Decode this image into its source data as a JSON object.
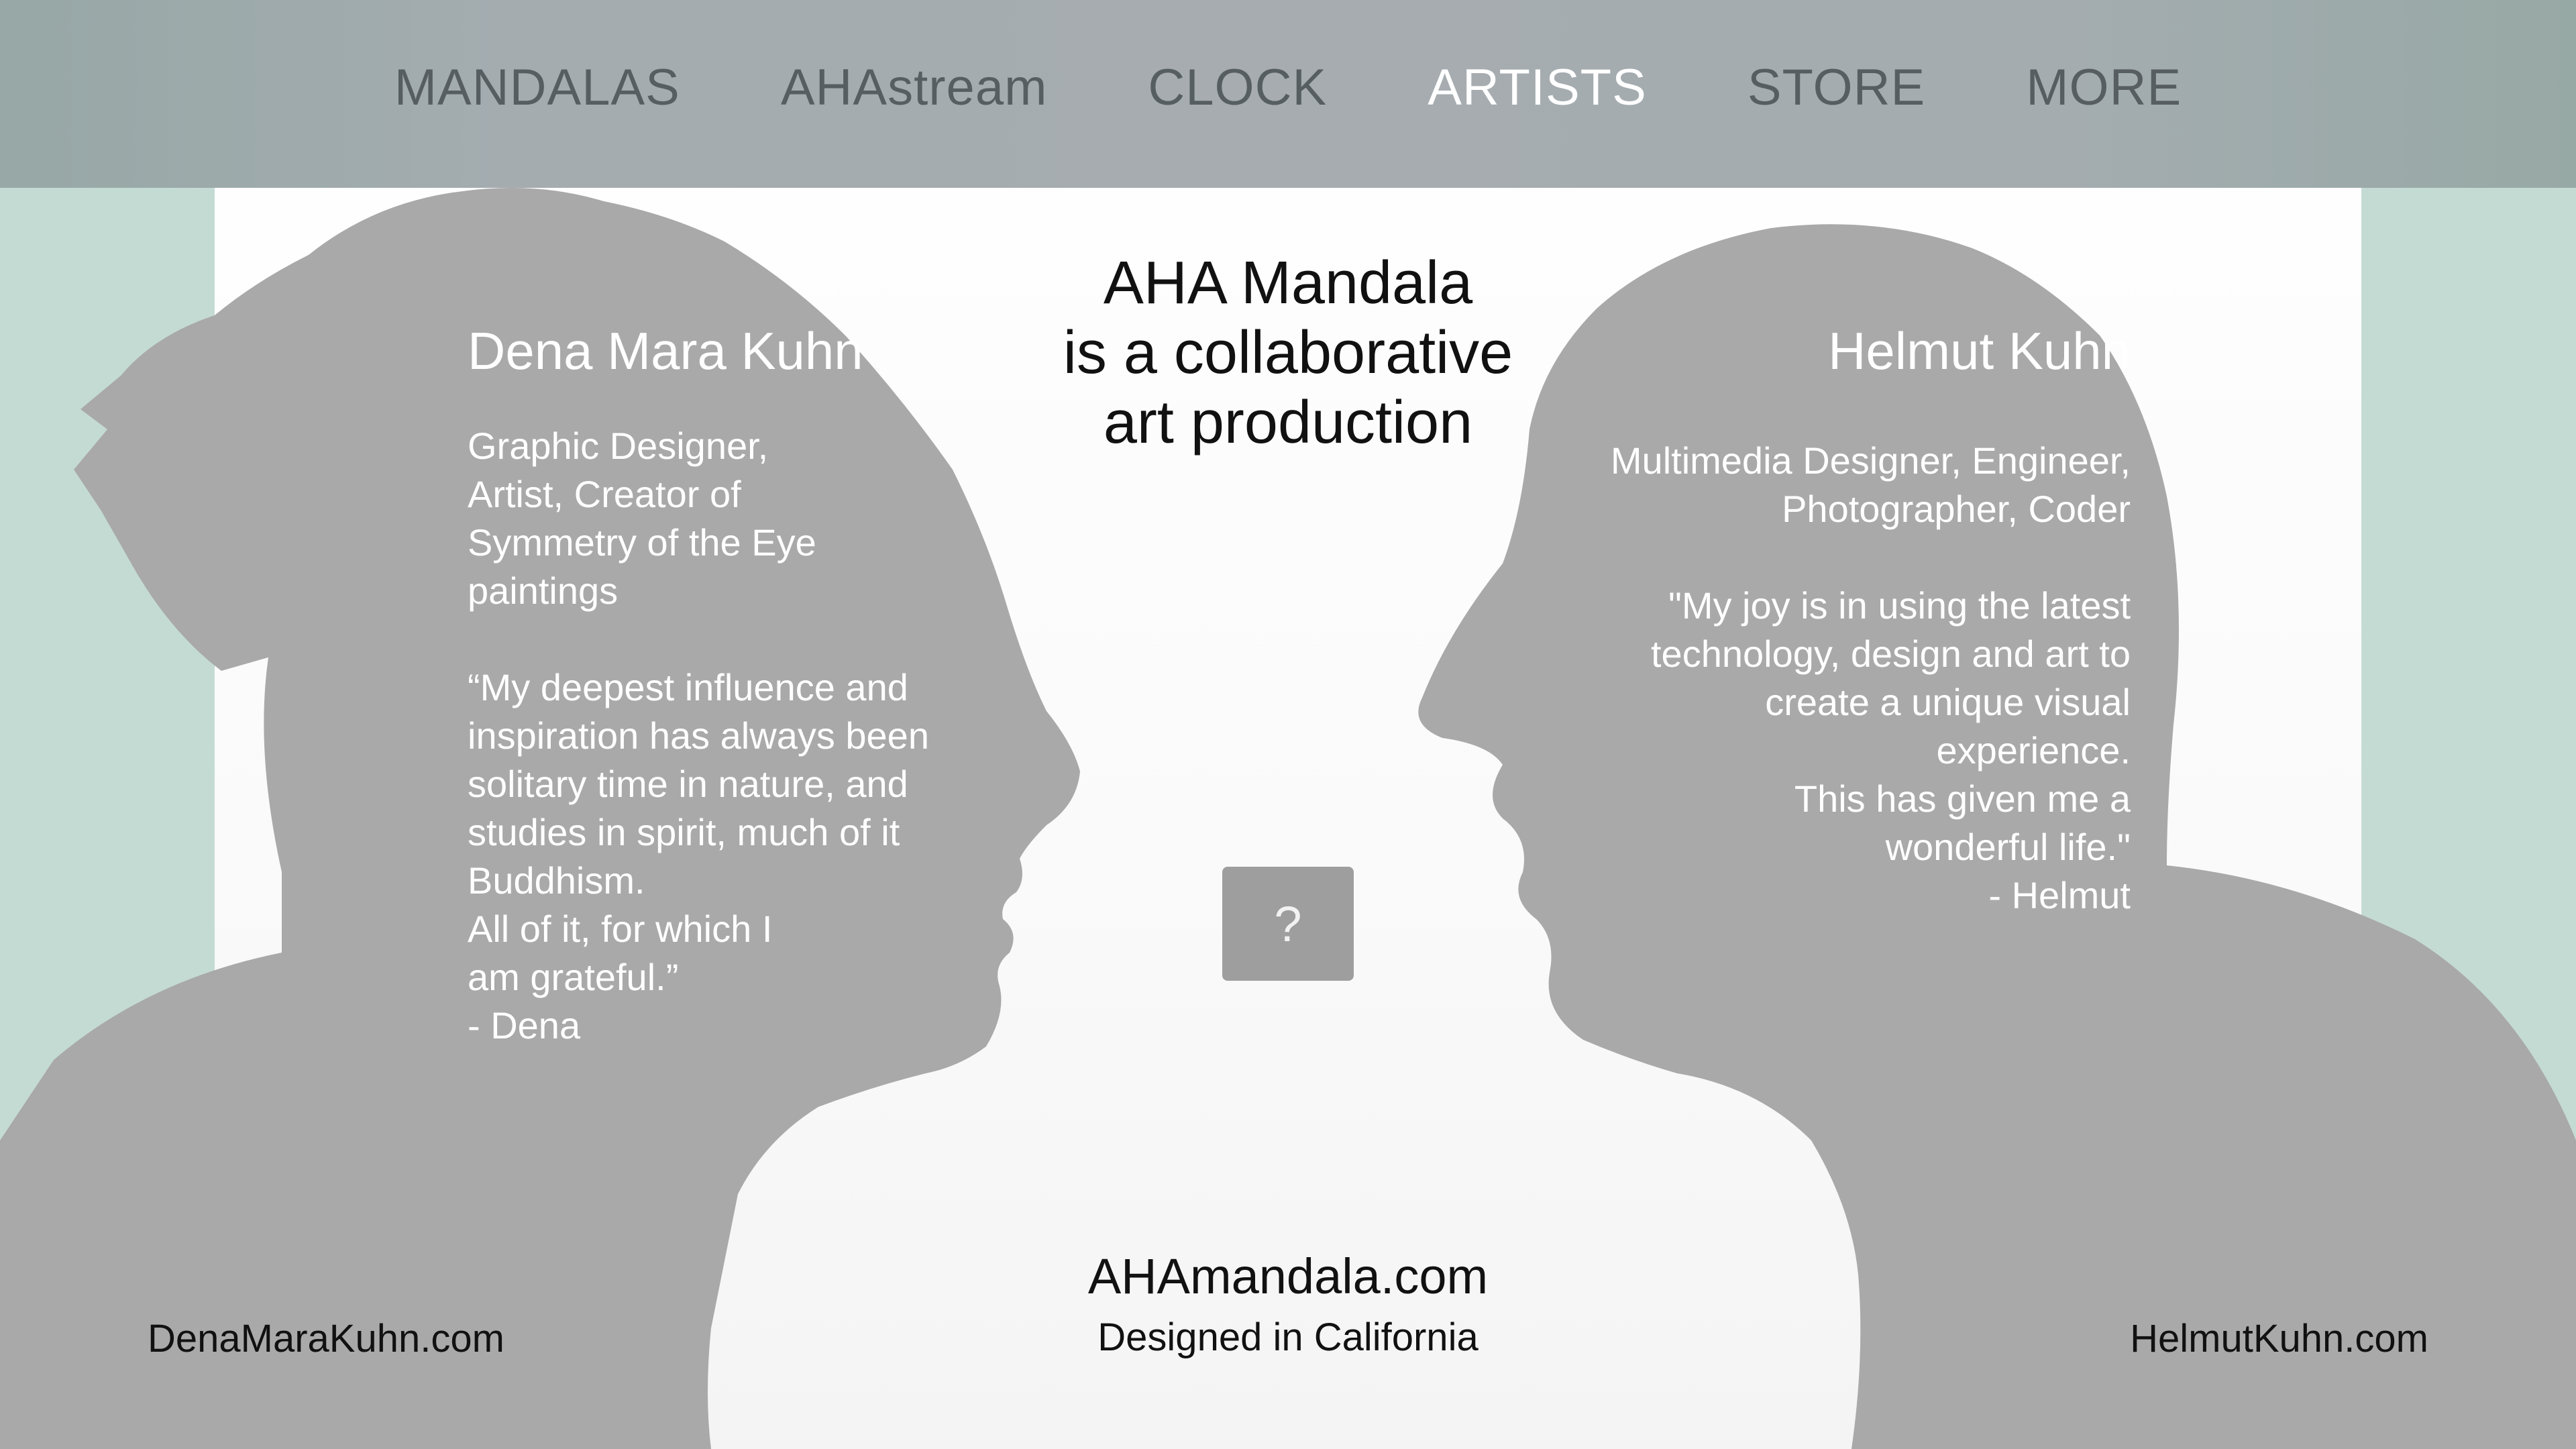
{
  "nav": {
    "items": [
      {
        "label": "MANDALAS",
        "active": false
      },
      {
        "label": "AHAstream",
        "active": false
      },
      {
        "label": "CLOCK",
        "active": false
      },
      {
        "label": "ARTISTS",
        "active": true
      },
      {
        "label": "STORE",
        "active": false
      },
      {
        "label": "MORE",
        "active": false
      }
    ]
  },
  "center": {
    "title_lines": [
      "AHA Mandala",
      "is a collaborative",
      "art production"
    ],
    "help_label": "?",
    "site_url": "AHAmandala.com",
    "tagline": "Designed in California"
  },
  "artists": {
    "left": {
      "name": "Dena Mara Kuhn",
      "desc_lines": [
        "Graphic Designer,",
        "Artist, Creator of",
        "Symmetry of the Eye",
        "paintings"
      ],
      "quote_lines": [
        "“My deepest influence and",
        "inspiration has always been",
        "solitary time in nature, and",
        "studies in spirit, much of it",
        "Buddhism.",
        "All of it, for which I",
        "am grateful.”",
        "- Dena"
      ],
      "site": "DenaMaraKuhn.com"
    },
    "right": {
      "name": "Helmut Kuhn",
      "desc_lines": [
        "Multimedia Designer, Engineer,",
        "Photographer, Coder"
      ],
      "quote_lines": [
        "\"My joy is in using the latest",
        "technology, design and art to",
        "create a unique visual",
        "experience.",
        "This has given me a",
        "wonderful life.\"",
        "- Helmut"
      ],
      "site": "HelmutKuhn.com"
    }
  },
  "colors": {
    "nav_text": "#575e61",
    "nav_active": "#ffffff",
    "silhouette": "#a9a9a9",
    "side_tint": "#c4dbd3"
  }
}
